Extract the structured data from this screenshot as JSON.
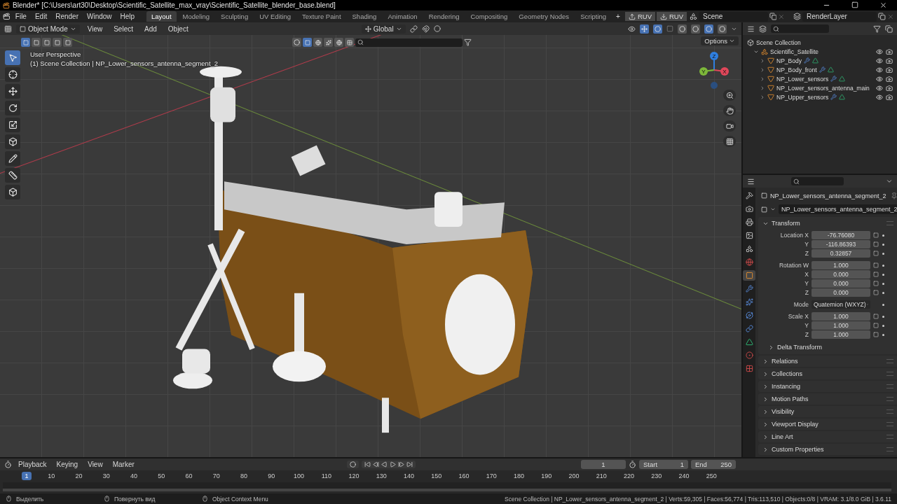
{
  "window": {
    "title": "Blender* [C:\\Users\\art30\\Desktop\\Scientific_Satellite_max_vray\\Scientific_Satellite_blender_base.blend]"
  },
  "menu": [
    "File",
    "Edit",
    "Render",
    "Window",
    "Help"
  ],
  "workspaces": [
    {
      "label": "Layout",
      "selected": true
    },
    {
      "label": "Modeling",
      "selected": false
    },
    {
      "label": "Sculpting",
      "selected": false
    },
    {
      "label": "UV Editing",
      "selected": false
    },
    {
      "label": "Texture Paint",
      "selected": false
    },
    {
      "label": "Shading",
      "selected": false
    },
    {
      "label": "Animation",
      "selected": false
    },
    {
      "label": "Rendering",
      "selected": false
    },
    {
      "label": "Compositing",
      "selected": false
    },
    {
      "label": "Geometry Nodes",
      "selected": false
    },
    {
      "label": "Scripting",
      "selected": false
    }
  ],
  "add_workspace": "+",
  "top_buttons": [
    {
      "kind": "upload",
      "label": "RUV"
    },
    {
      "kind": "download",
      "label": "RUV"
    }
  ],
  "scene": "Scene",
  "view_layer": "RenderLayer",
  "viewport": {
    "mode": "Object Mode",
    "menus": [
      "View",
      "Select",
      "Add",
      "Object"
    ],
    "orientation": "Global",
    "options": "Options",
    "view_name": "User Perspective",
    "collection_path": "(1) Scene Collection | NP_Lower_sensors_antenna_segment_2",
    "select_modes": [
      {
        "selected": true
      },
      {
        "selected": false
      },
      {
        "selected": false
      },
      {
        "selected": false
      },
      {
        "selected": false
      }
    ],
    "shading_modes": [
      {
        "selected": false
      },
      {
        "selected": false
      },
      {
        "selected": true
      },
      {
        "selected": false
      }
    ],
    "tools": [
      {
        "kind": "select",
        "selected": true
      },
      {
        "kind": "cursor",
        "selected": false
      },
      {
        "kind": "move",
        "selected": false
      },
      {
        "kind": "rotate",
        "selected": false
      },
      {
        "kind": "scale",
        "selected": false
      },
      {
        "kind": "transform",
        "selected": false
      },
      {
        "kind": "annotate",
        "selected": false
      },
      {
        "kind": "measure",
        "selected": false
      },
      {
        "kind": "add_cube",
        "selected": false
      }
    ],
    "gizmo_axes": [
      {
        "label": "Z",
        "color": "#2f7fe0"
      },
      {
        "label": "Y",
        "color": "#7db83a"
      },
      {
        "label": "X",
        "color": "#e0475a"
      }
    ]
  },
  "outliner": {
    "root": "Scene Collection",
    "items": [
      {
        "name": "Scientific_Satellite",
        "expanded": true,
        "children": [
          {
            "name": "NP_Body",
            "has_modifier": true
          },
          {
            "name": "NP_Body_front",
            "has_modifier": true
          },
          {
            "name": "NP_Lower_sensors",
            "has_modifier": true
          },
          {
            "name": "NP_Lower_sensors_antenna_main",
            "has_modifier": false
          },
          {
            "name": "NP_Upper_sensors",
            "has_modifier": true
          }
        ]
      }
    ]
  },
  "properties": {
    "tabs": [
      {
        "kind": "tool",
        "selected": false
      },
      {
        "kind": "render",
        "selected": false
      },
      {
        "kind": "output",
        "selected": false
      },
      {
        "kind": "view_layer",
        "selected": false
      },
      {
        "kind": "scene",
        "selected": false
      },
      {
        "kind": "world",
        "selected": false
      },
      {
        "kind": "object",
        "selected": true
      },
      {
        "kind": "modifier",
        "selected": false
      },
      {
        "kind": "particles",
        "selected": false
      },
      {
        "kind": "physics",
        "selected": false
      },
      {
        "kind": "constraints",
        "selected": false
      },
      {
        "kind": "data",
        "selected": false
      },
      {
        "kind": "material",
        "selected": false
      },
      {
        "kind": "texture",
        "selected": false
      }
    ],
    "object_name": "NP_Lower_sensors_antenna_segment_2",
    "data_name": "NP_Lower_sensors_antenna_segment_2",
    "transform": {
      "title": "Transform",
      "expanded": true,
      "groups": [
        [
          {
            "label": "Location X",
            "value": "-76.76080"
          },
          {
            "label": "Y",
            "value": "-116.86393"
          },
          {
            "label": "Z",
            "value": "0.32857"
          }
        ],
        [
          {
            "label": "Rotation W",
            "value": "1.000"
          },
          {
            "label": "X",
            "value": "0.000"
          },
          {
            "label": "Y",
            "value": "0.000"
          },
          {
            "label": "Z",
            "value": "0.000"
          }
        ],
        [
          {
            "label": "Mode",
            "value": "Quaternion (WXYZ)",
            "kind": "dropdown"
          }
        ],
        [
          {
            "label": "Scale X",
            "value": "1.000"
          },
          {
            "label": "Y",
            "value": "1.000"
          },
          {
            "label": "Z",
            "value": "1.000"
          }
        ]
      ],
      "subpanel": "Delta Transform"
    },
    "panels": [
      "Relations",
      "Collections",
      "Instancing",
      "Motion Paths",
      "Visibility",
      "Viewport Display",
      "Line Art",
      "Custom Properties"
    ]
  },
  "timeline": {
    "menus": [
      "Playback",
      "Keying",
      "View",
      "Marker"
    ],
    "current_frame": "1",
    "start_label": "Start",
    "start": "1",
    "end_label": "End",
    "end": "250",
    "marker": "1",
    "ticks": [
      "10",
      "20",
      "30",
      "40",
      "50",
      "60",
      "70",
      "80",
      "90",
      "100",
      "110",
      "120",
      "130",
      "140",
      "150",
      "160",
      "170",
      "180",
      "190",
      "200",
      "210",
      "220",
      "230",
      "240",
      "250"
    ]
  },
  "status_bar": {
    "hints": [
      "Выделить",
      "Повернуть вид",
      "Object Context Menu"
    ],
    "info": "Scene Collection | NP_Lower_sensors_antenna_segment_2 | Verts:59,305 | Faces:56,774 | Tris:113,510 | Objects:0/8 | VRAM: 3.1/8.0 GiB | 3.6.11"
  }
}
